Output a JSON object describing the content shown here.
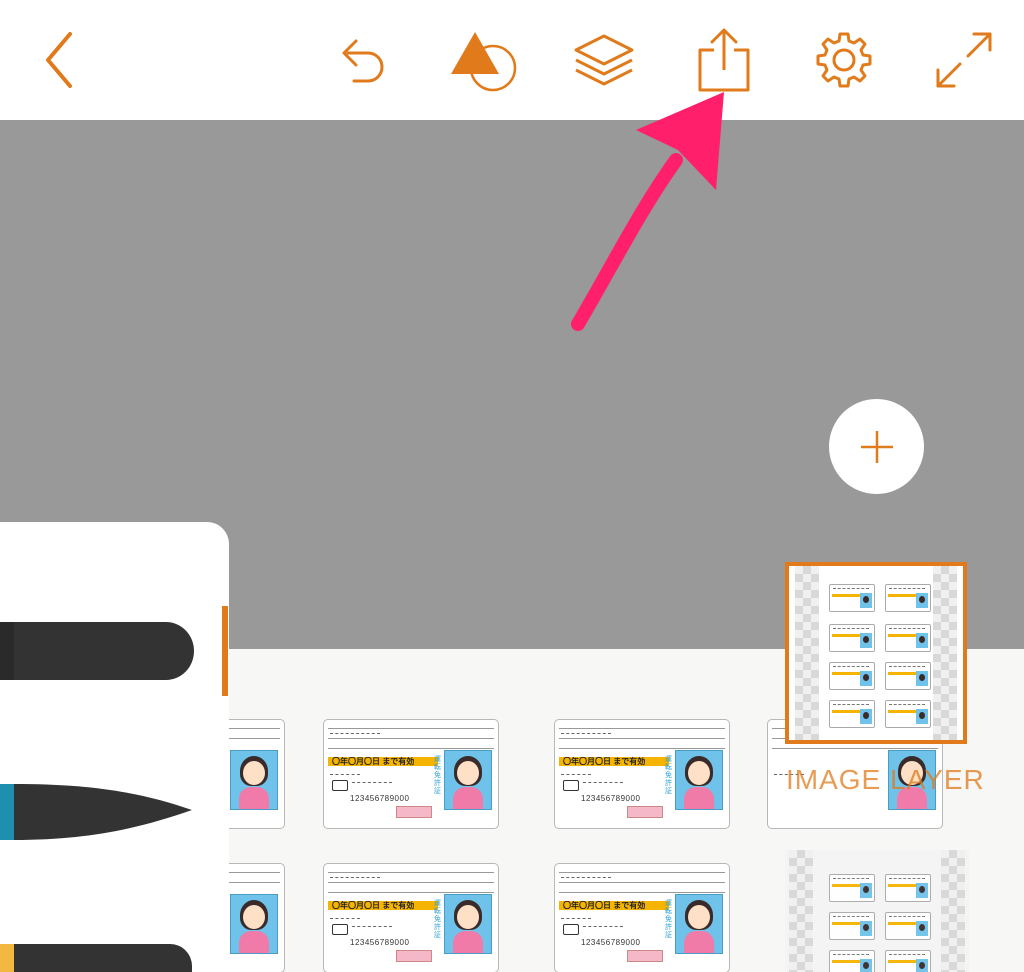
{
  "colors": {
    "accent": "#e07a1a",
    "canvas_bg": "#999999",
    "toolbar_bg": "#ffffff",
    "annotation_arrow": "#ff1f6b"
  },
  "toolbar": {
    "items": [
      {
        "id": "back",
        "icon": "chevron-left-icon"
      },
      {
        "id": "undo",
        "icon": "undo-icon"
      },
      {
        "id": "shapes",
        "icon": "shapes-icon"
      },
      {
        "id": "layers",
        "icon": "layers-icon"
      },
      {
        "id": "share",
        "icon": "share-export-icon"
      },
      {
        "id": "settings",
        "icon": "gear-icon"
      },
      {
        "id": "fullscreen",
        "icon": "expand-icon"
      }
    ]
  },
  "add_layer": {
    "icon": "plus-icon"
  },
  "layers_panel": {
    "label": "IMAGE LAYER"
  },
  "license_card": {
    "band_text": "〇年〇月〇日 まで有効",
    "number": "123456789000",
    "vertical_text": "運転免許証"
  },
  "annotation": {
    "icon": "pointer-arrow-icon"
  }
}
